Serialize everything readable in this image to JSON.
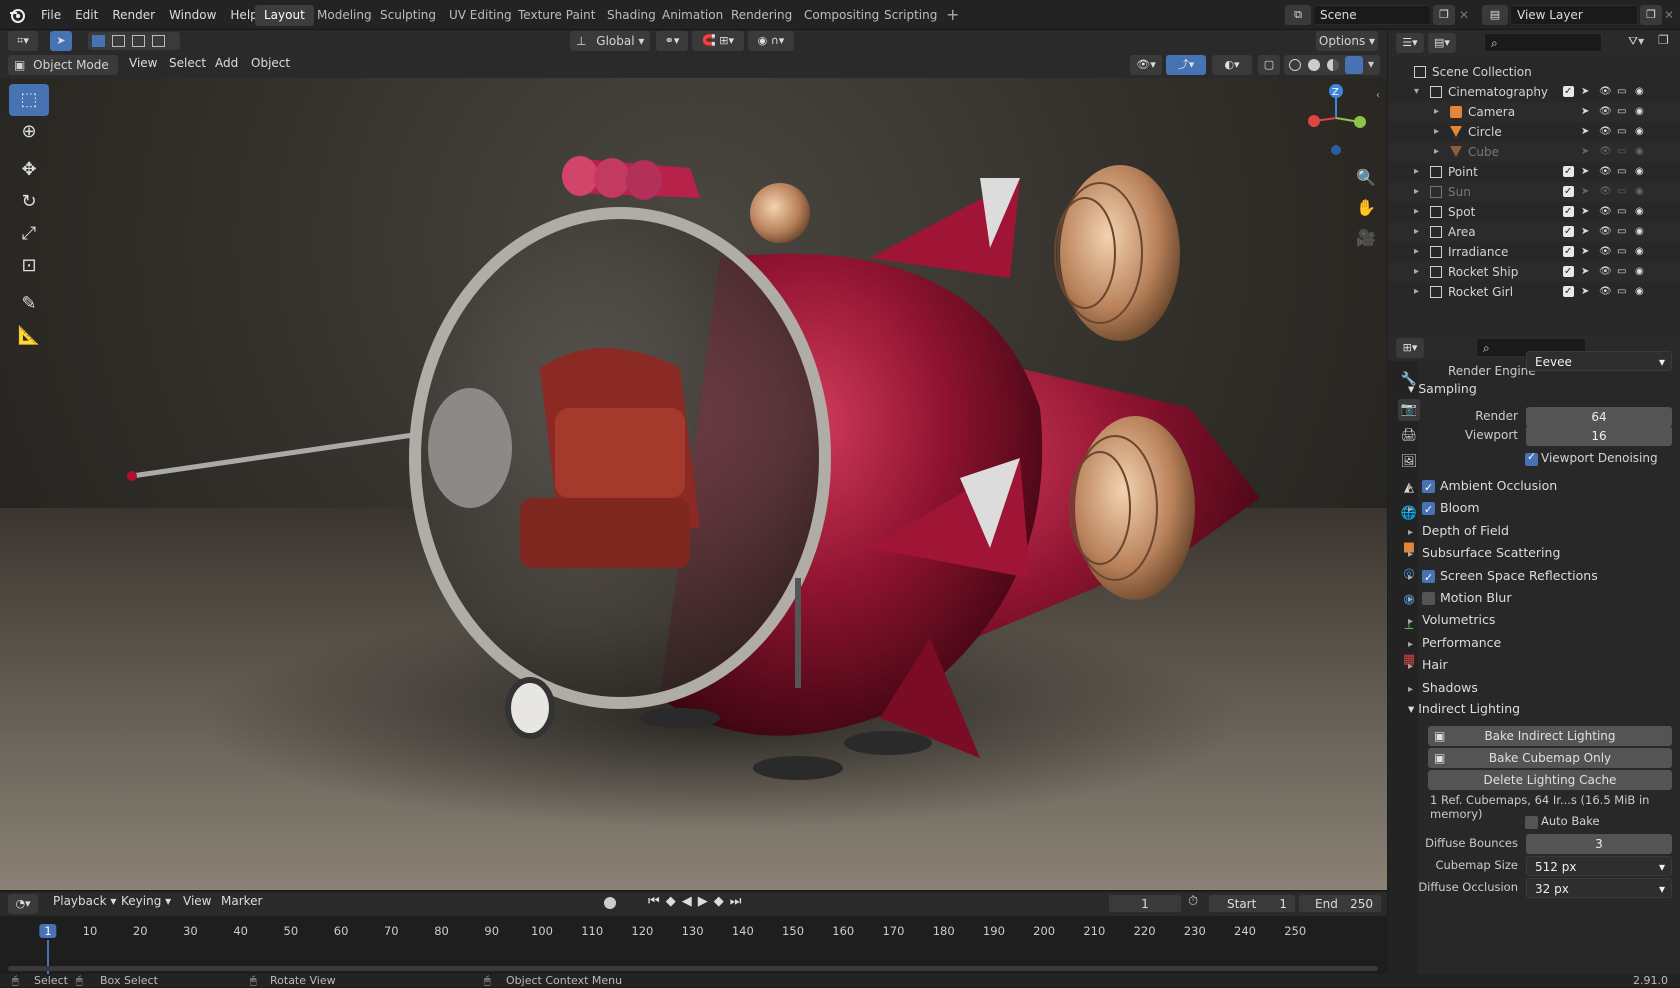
{
  "menus": [
    "File",
    "Edit",
    "Render",
    "Window",
    "Help"
  ],
  "workspaces": [
    "Layout",
    "Modeling",
    "Sculpting",
    "UV Editing",
    "Texture Paint",
    "Shading",
    "Animation",
    "Rendering",
    "Compositing",
    "Scripting"
  ],
  "scene": "Scene",
  "view_layer": "View Layer",
  "header": {
    "orientation": "Global",
    "options": "Options",
    "mode": "Object Mode",
    "view": "View",
    "select": "Select",
    "add": "Add",
    "object": "Object"
  },
  "gizmo": {
    "z": "Z"
  },
  "outliner": {
    "root": "Scene Collection",
    "rows": [
      {
        "label": "Cinematography",
        "indent": 1,
        "expanded": true,
        "dim": false,
        "kind": "collection",
        "checkbox": true
      },
      {
        "label": "Camera",
        "indent": 2,
        "dim": false,
        "kind": "camera",
        "checkbox": false
      },
      {
        "label": "Circle",
        "indent": 2,
        "dim": false,
        "kind": "mesh",
        "checkbox": false
      },
      {
        "label": "Cube",
        "indent": 2,
        "dim": true,
        "kind": "mesh",
        "checkbox": false
      },
      {
        "label": "Point",
        "indent": 1,
        "dim": false,
        "kind": "collection",
        "checkbox": true
      },
      {
        "label": "Sun",
        "indent": 1,
        "dim": true,
        "kind": "collection",
        "checkbox": true
      },
      {
        "label": "Spot",
        "indent": 1,
        "dim": false,
        "kind": "collection",
        "checkbox": true
      },
      {
        "label": "Area",
        "indent": 1,
        "dim": false,
        "kind": "collection",
        "checkbox": true
      },
      {
        "label": "Irradiance",
        "indent": 1,
        "dim": false,
        "kind": "collection",
        "checkbox": true
      },
      {
        "label": "Rocket Ship",
        "indent": 1,
        "dim": false,
        "kind": "collection",
        "checkbox": true
      },
      {
        "label": "Rocket Girl",
        "indent": 1,
        "dim": false,
        "kind": "collection",
        "checkbox": true
      }
    ]
  },
  "props": {
    "render_engine_label": "Render Engine",
    "render_engine": "Eevee",
    "sampling": "Sampling",
    "render_label": "Render",
    "render_value": "64",
    "viewport_label": "Viewport",
    "viewport_value": "16",
    "viewport_denoising": "Viewport Denoising",
    "sections": [
      {
        "label": "Ambient Occlusion",
        "checkbox": "on"
      },
      {
        "label": "Bloom",
        "checkbox": "on"
      },
      {
        "label": "Depth of Field",
        "checkbox": "none"
      },
      {
        "label": "Subsurface Scattering",
        "checkbox": "none"
      },
      {
        "label": "Screen Space Reflections",
        "checkbox": "on"
      },
      {
        "label": "Motion Blur",
        "checkbox": "off"
      },
      {
        "label": "Volumetrics",
        "checkbox": "none"
      },
      {
        "label": "Performance",
        "checkbox": "none"
      },
      {
        "label": "Hair",
        "checkbox": "none"
      },
      {
        "label": "Shadows",
        "checkbox": "none"
      }
    ],
    "indirect": "Indirect Lighting",
    "bake_indirect": "Bake Indirect Lighting",
    "bake_cubemap": "Bake Cubemap Only",
    "delete_cache": "Delete Lighting Cache",
    "cache_info": "1 Ref. Cubemaps, 64 Ir...s (16.5 MiB in memory)",
    "auto_bake": "Auto Bake",
    "diffuse_bounces_label": "Diffuse Bounces",
    "diffuse_bounces": "3",
    "cubemap_size_label": "Cubemap Size",
    "cubemap_size": "512 px",
    "diffuse_occlusion_label": "Diffuse Occlusion",
    "diffuse_occlusion": "32 px"
  },
  "timeline": {
    "playback": "Playback",
    "keying": "Keying",
    "view": "View",
    "marker": "Marker",
    "current_frame": "1",
    "start_label": "Start",
    "start": "1",
    "end_label": "End",
    "end": "250",
    "ticks": [
      "1",
      "10",
      "20",
      "30",
      "40",
      "50",
      "60",
      "70",
      "80",
      "90",
      "100",
      "110",
      "120",
      "130",
      "140",
      "150",
      "160",
      "170",
      "180",
      "190",
      "200",
      "210",
      "220",
      "230",
      "240",
      "250"
    ]
  },
  "status": {
    "select": "Select",
    "box_select": "Box Select",
    "rotate": "Rotate View",
    "context": "Object Context Menu",
    "version": "2.91.0"
  }
}
